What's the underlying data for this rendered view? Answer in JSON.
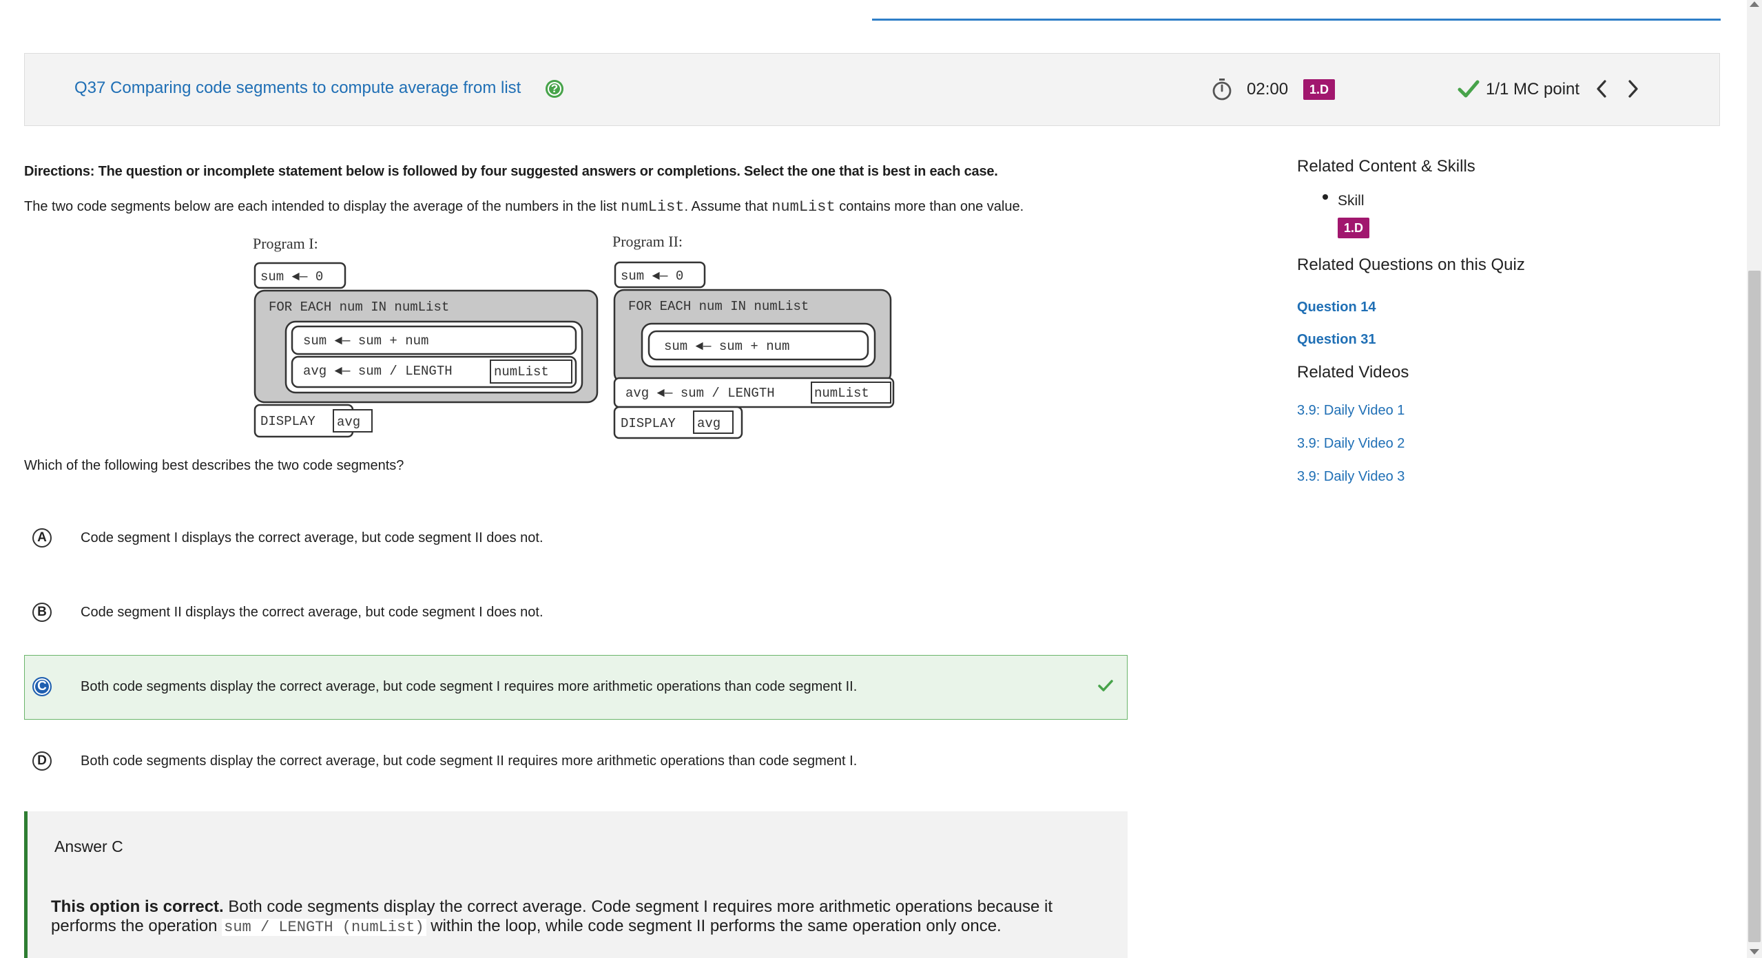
{
  "header": {
    "title": "Q37 Comparing code segments to compute average from list",
    "help_symbol": "?",
    "timer": "02:00",
    "skill_badge": "1.D",
    "points": "1/1 MC point",
    "icons": [
      "help-icon",
      "stopwatch-icon",
      "checkmark-icon",
      "chevron-left-icon",
      "chevron-right-icon"
    ]
  },
  "content": {
    "directions": "Directions: The question or incomplete statement below is followed by four suggested answers or completions. Select the one that is best in each case.",
    "prompt_before": "The two code segments below are each intended to display the average of the numbers in the list ",
    "prompt_code_1": "numList",
    "prompt_middle": ". Assume that ",
    "prompt_code_2": "numList",
    "prompt_after": " contains more than one value.",
    "question": "Which of the following best describes the two code segments?"
  },
  "figure": {
    "program1": {
      "label": "Program I:",
      "init": "sum ◄— 0",
      "loop": "FOR EACH num IN numList",
      "body1": "sum ◄— sum + num",
      "body2": "avg ◄— sum / LENGTH",
      "body2_box": "numList",
      "display": "DISPLAY",
      "display_box": "avg"
    },
    "program2": {
      "label": "Program II:",
      "init": "sum ◄— 0",
      "loop": "FOR EACH num IN numList",
      "body1": "sum ◄— sum + num",
      "after": "avg ◄— sum / LENGTH",
      "after_box": "numList",
      "display": "DISPLAY",
      "display_box": "avg"
    }
  },
  "choices": [
    {
      "letter": "A",
      "text": "Code segment I displays the correct average, but code segment II does not.",
      "correct": false
    },
    {
      "letter": "B",
      "text": "Code segment II displays the correct average, but code segment I does not.",
      "correct": false
    },
    {
      "letter": "C",
      "text": "Both code segments display the correct average, but code segment I requires more arithmetic operations than code segment II.",
      "correct": true
    },
    {
      "letter": "D",
      "text": "Both code segments display the correct average, but code segment II requires more arithmetic operations than code segment I.",
      "correct": false
    }
  ],
  "answer": {
    "title": "Answer C",
    "lead": "This option is correct.",
    "text_1": " Both code segments display the correct average. Code segment I requires more arithmetic operations because it performs the operation ",
    "code": "sum / LENGTH (numList)",
    "text_2": " within the loop, while code segment II performs the same operation only once."
  },
  "sidebar": {
    "related_heading": "Related Content & Skills",
    "skill_label": "Skill",
    "skill_badge": "1.D",
    "questions_heading": "Related Questions on this Quiz",
    "questions": [
      "Question 14",
      "Question 31"
    ],
    "videos_heading": "Related Videos",
    "videos": [
      "3.9: Daily Video 1",
      "3.9: Daily Video 2",
      "3.9: Daily Video 3"
    ]
  },
  "colors": {
    "link": "#1f6fb5",
    "badge": "#a1176e",
    "correct_green": "#47a34a",
    "correct_bg": "#e9f4e9",
    "selected_blue": "#1f5fb0"
  }
}
